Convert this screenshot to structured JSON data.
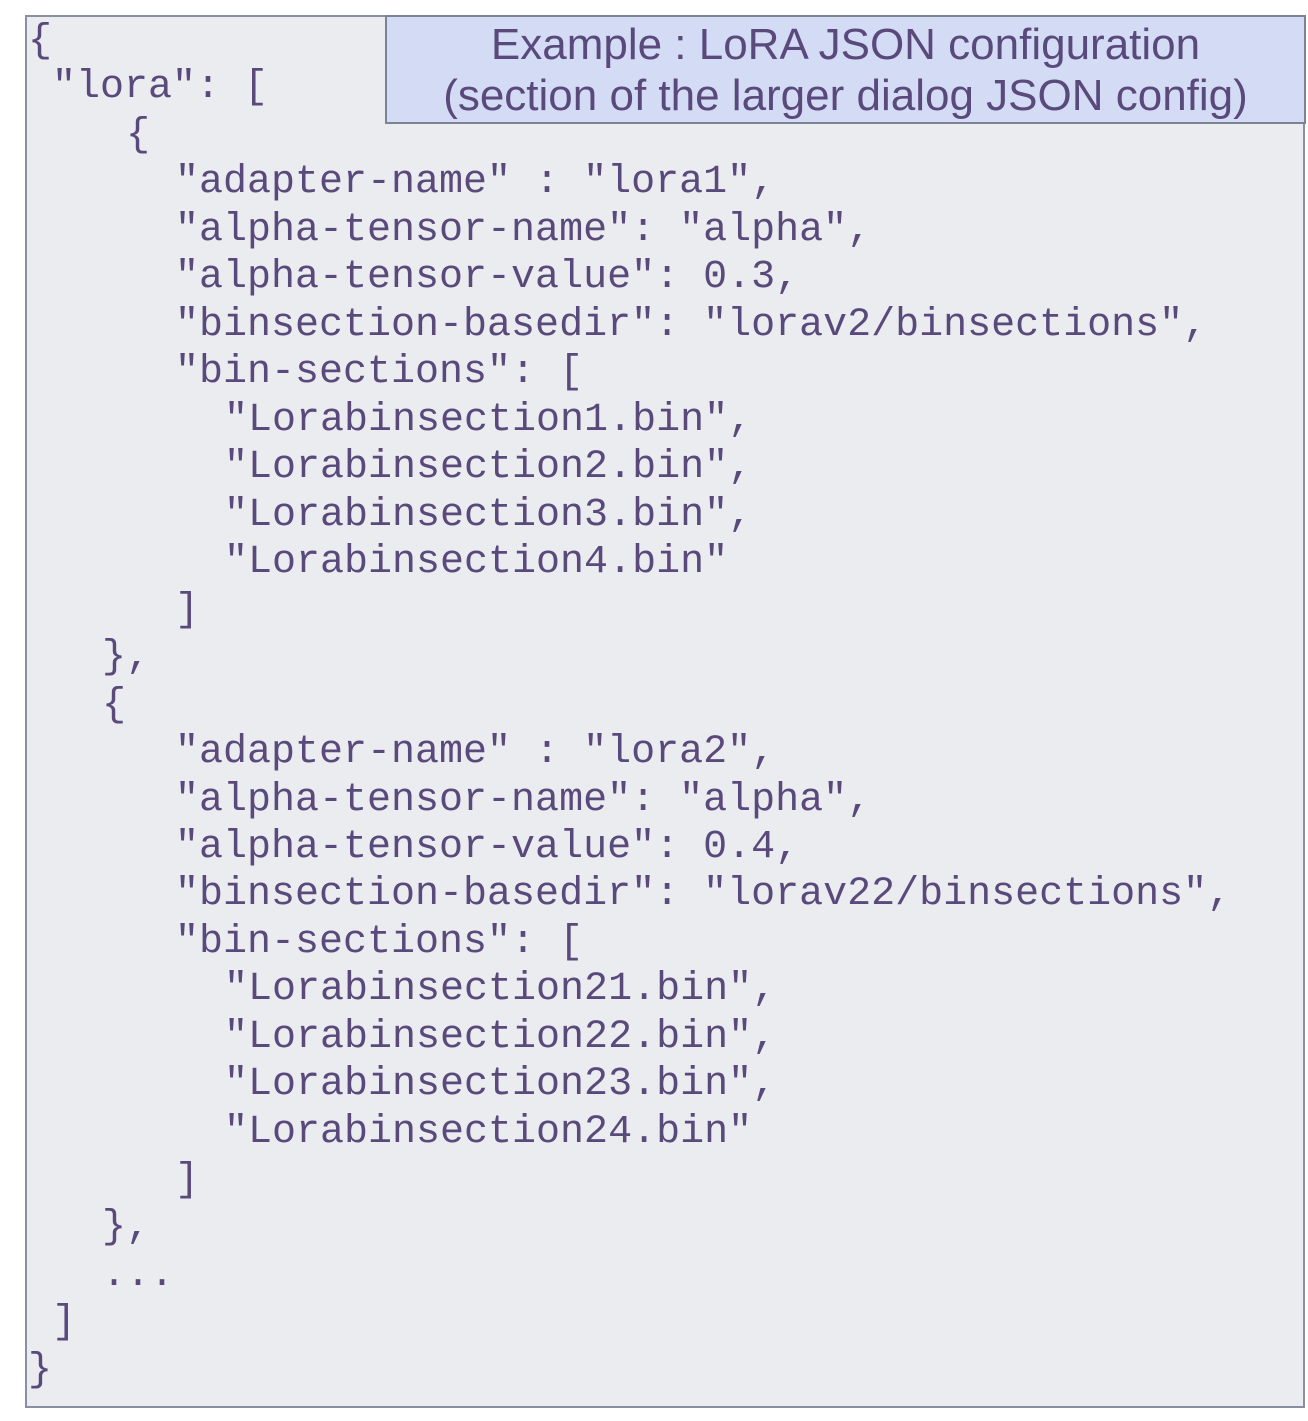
{
  "callout": {
    "line1": "Example : LoRA JSON configuration",
    "line2": "(section of the larger dialog JSON config)"
  },
  "code_lines": [
    "{",
    "\"lora\": [",
    "{",
    "\"adapter-name\" : \"lora1\",",
    "\"alpha-tensor-name\": \"alpha\",",
    "\"alpha-tensor-value\": 0.3,",
    "\"binsection-basedir\": \"lorav2/binsections\",",
    "\"bin-sections\": [",
    "\"Lorabinsection1.bin\",",
    "\"Lorabinsection2.bin\",",
    "\"Lorabinsection3.bin\",",
    "\"Lorabinsection4.bin\"",
    "]",
    "},",
    "{",
    "\"adapter-name\" : \"lora2\",",
    "\"alpha-tensor-name\": \"alpha\",",
    "\"alpha-tensor-value\": 0.4,",
    "\"binsection-basedir\": \"lorav22/binsections\",",
    "\"bin-sections\": [",
    "\"Lorabinsection21.bin\",",
    "\"Lorabinsection22.bin\",",
    "\"Lorabinsection23.bin\",",
    "\"Lorabinsection24.bin\"",
    "]",
    "},",
    "...",
    "]",
    "}"
  ]
}
